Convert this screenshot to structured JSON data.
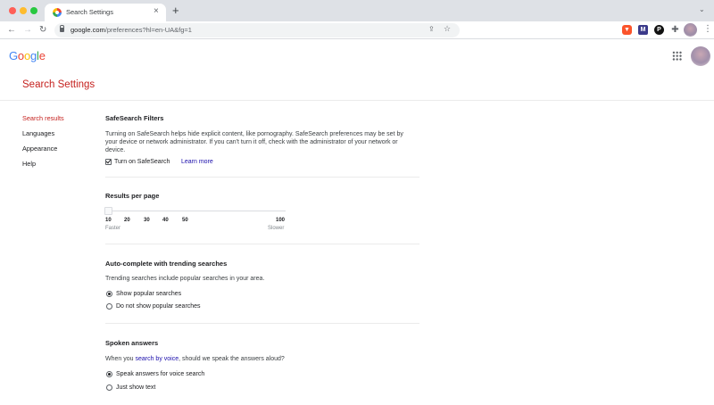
{
  "browser": {
    "tab_title": "Search Settings",
    "tab_close": "×",
    "new_tab": "+",
    "url_host": "google.com",
    "url_path": "/preferences?hl=en-UA&fg=1",
    "extensions": [
      "brave-icon",
      "m-extension-icon",
      "p-extension-icon",
      "puzzle-icon"
    ]
  },
  "header": {
    "logo": [
      "G",
      "o",
      "o",
      "g",
      "l",
      "e"
    ],
    "logo_colors": [
      "#4285f4",
      "#ea4335",
      "#fbbc05",
      "#4285f4",
      "#34a853",
      "#ea4335"
    ]
  },
  "page_title": "Search Settings",
  "nav": {
    "items": [
      "Search results",
      "Languages",
      "Appearance",
      "Help"
    ],
    "active_color": "#c5221f"
  },
  "safesearch": {
    "title": "SafeSearch Filters",
    "description": "Turning on SafeSearch helps hide explicit content, like pornography. SafeSearch preferences may be set by your device or network administrator. If you can't turn it off, check with the administrator of your network or device.",
    "checkbox_label": "Turn on SafeSearch",
    "checked": true,
    "learn_more": "Learn more"
  },
  "results_per_page": {
    "title": "Results per page",
    "ticks": [
      "10",
      "20",
      "30",
      "40",
      "50",
      "100"
    ],
    "value": 10,
    "min_label": "Faster",
    "max_label": "Slower"
  },
  "autocomplete": {
    "title": "Auto-complete with trending searches",
    "description": "Trending searches include popular searches in your area.",
    "options": [
      "Show popular searches",
      "Do not show popular searches"
    ],
    "selected": 0
  },
  "spoken": {
    "title": "Spoken answers",
    "description_prefix": "When you ",
    "description_link": "search by voice",
    "description_suffix": ", should we speak the answers aloud?",
    "options": [
      "Speak answers for voice search",
      "Just show text"
    ],
    "selected": 0
  }
}
